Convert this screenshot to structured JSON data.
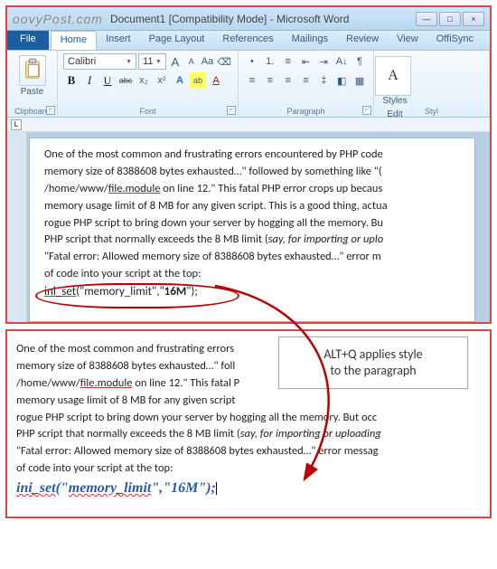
{
  "watermark": "oovyPost.com",
  "window_title": "Document1 [Compatibility Mode] - Microsoft Word",
  "win_controls": {
    "min": "—",
    "max": "□",
    "close": "×"
  },
  "tabs": {
    "file": "File",
    "home": "Home",
    "insert": "Insert",
    "page_layout": "Page Layout",
    "references": "References",
    "mailings": "Mailings",
    "review": "Review",
    "view": "View",
    "offisync": "OffiSync"
  },
  "ribbon": {
    "clipboard": {
      "paste": "Paste",
      "label": "Clipboard",
      "launcher": "⌐"
    },
    "font": {
      "label": "Font",
      "name": "Calibri",
      "size": "11",
      "grow": "A",
      "shrink": "A",
      "case": "Aa",
      "clear": "⌫",
      "bold": "B",
      "italic": "I",
      "underline": "U",
      "strike": "abc",
      "sub": "x₂",
      "sup": "x²",
      "effects": "A",
      "highlight": "ab",
      "color": "A"
    },
    "paragraph": {
      "label": "Paragraph",
      "bullets": "•",
      "numbers": "1.",
      "multilevel": "≡",
      "outdent": "⇤",
      "indent": "⇥",
      "sort": "A↓",
      "marks": "¶",
      "al": "≡",
      "ac": "≡",
      "ar": "≡",
      "aj": "≡",
      "spacing": "‡",
      "shading": "◧",
      "borders": "▦"
    },
    "styles": {
      "label": "Styl",
      "styles_btn": "Styles",
      "change": "Edit"
    }
  },
  "doc": {
    "l1": "One of the most common and frustrating errors encountered by PHP code",
    "l2_a": "memory size of 8388608 bytes exhausted…\" followed by something like \"(",
    "l3_a": "/home/www/",
    "l3_b": "file.module",
    "l3_c": "  on line 12.\" This fatal PHP error crops up becaus",
    "l4": "memory usage limit of 8 MB for any given script. This is a good thing, actua",
    "l5": "rogue PHP script to bring down your server by hogging all the memory. Bu",
    "l6_a": "PHP script that normally exceeds the 8 MB limit (",
    "l6_b": "say, for importing or uplo",
    "l7": "\"Fatal error: Allowed memory size of 8388608 bytes exhausted…\" error m",
    "l8": "of code into your script at the top:",
    "code_a": "ini_set",
    "code_b": "(\"memory_limit\",\"",
    "code_c": "16M",
    "code_d": "\");"
  },
  "callout": {
    "line1": "ALT+Q applies style",
    "line2": "to the paragraph"
  },
  "doc2": {
    "l1": "One of the most common and frustrating errors",
    "l2": "memory size of 8388608 bytes exhausted…\" foll",
    "l3_a": "/home/www/",
    "l3_b": "file.module",
    "l3_c": "  on line 12.\" This fatal P",
    "l4": "memory usage limit of 8 MB for any given script",
    "l5": "rogue PHP script to bring down your server by hogging all the memory. But occ",
    "l6_a": "PHP script that normally exceeds the 8 MB limit (",
    "l6_b": "say, for importing or uploading",
    "l7": "\"Fatal error: Allowed memory size of 8388608 bytes exhausted…\" error messag",
    "l8": "of code into your script at the top:",
    "code_a": "ini_set",
    "code_b": "(\"",
    "code_c": "memory_limit",
    "code_d": "\",\"16M\");"
  }
}
